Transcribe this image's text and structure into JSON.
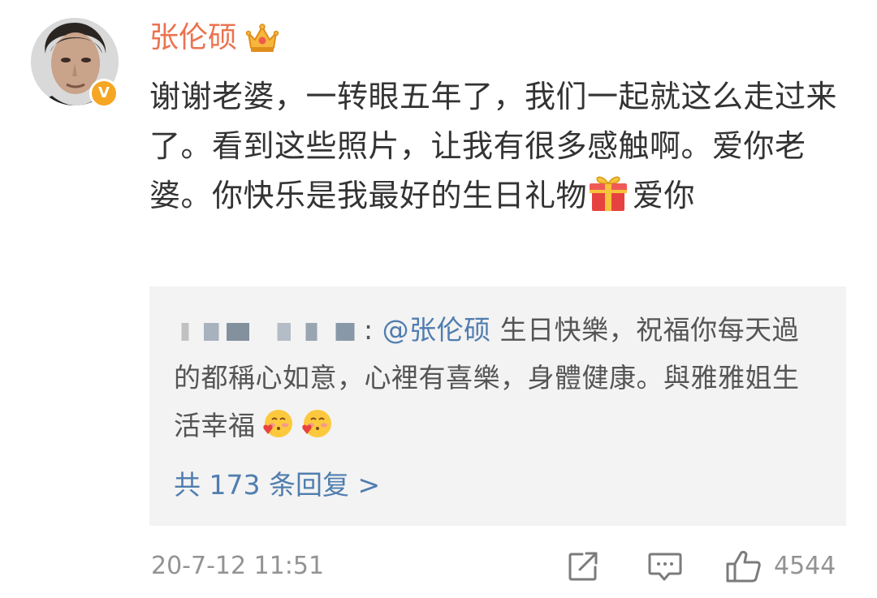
{
  "post": {
    "username": "张伦硕",
    "content": "谢谢老婆，一转眼五年了，我们一起就这么走过来了。看到这些照片，让我有很多感触啊。爱你老婆。你快乐是我最好的生日礼物",
    "content_after_emoji": "爱你",
    "verified_badge": "V",
    "gift_icon": "gift-emoji",
    "crown_icon": "crown-member-icon"
  },
  "reply": {
    "prefix": ":",
    "mention": "@张伦硕",
    "text": " 生日快樂，祝福你每天過的都稱心如意，心裡有喜樂，身體健康。與雅雅姐生活幸福",
    "emoji_icon": "blushing-heart-emoji",
    "reply_count": "共 173 条回复 >"
  },
  "footer": {
    "timestamp": "20-7-12 11:51",
    "like_count": "4544"
  },
  "colors": {
    "username": "#eb7350",
    "link": "#507daf",
    "muted": "#939393",
    "reply_bg": "#f3f3f3",
    "verified": "#f5a623"
  }
}
